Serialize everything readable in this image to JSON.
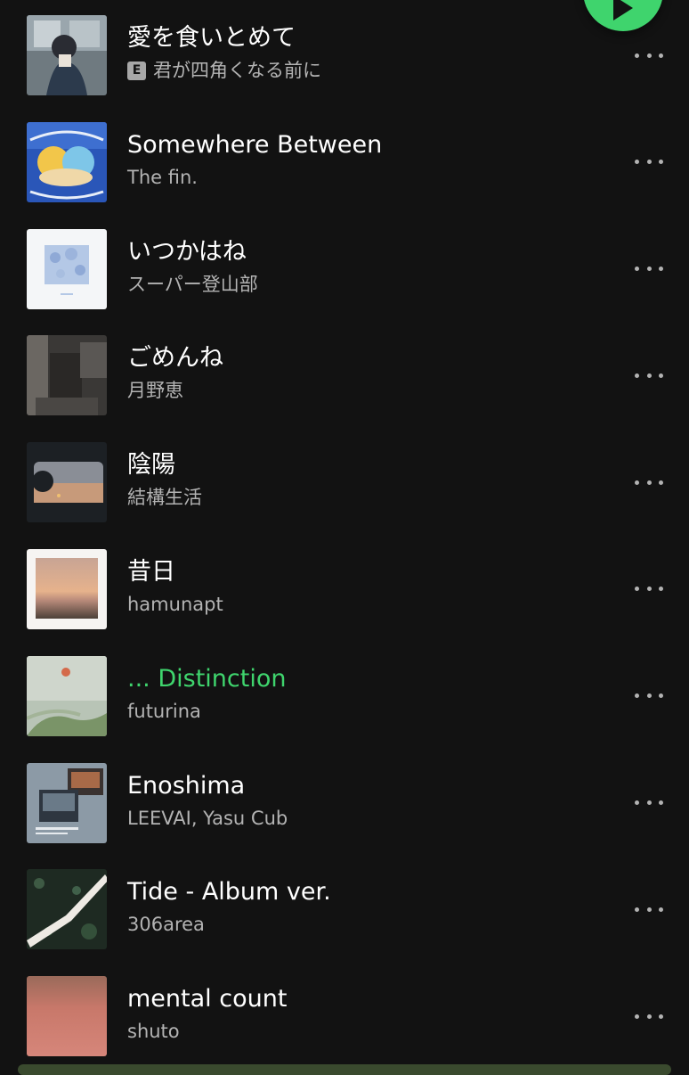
{
  "player": {
    "accent_color": "#3fd46d",
    "play_button_icon": "play-icon"
  },
  "tracks": [
    {
      "title": "愛を食いとめて",
      "artist": "君が四角くなる前に",
      "explicit": true,
      "explicit_label": "E",
      "active": false
    },
    {
      "title": "Somewhere Between",
      "artist": "The fin.",
      "explicit": false,
      "active": false
    },
    {
      "title": "いつかはね",
      "artist": "スーパー登山部",
      "explicit": false,
      "active": false
    },
    {
      "title": "ごめんね",
      "artist": "月野恵",
      "explicit": false,
      "active": false
    },
    {
      "title": "陰陽",
      "artist": "結構生活",
      "explicit": false,
      "active": false
    },
    {
      "title": "昔日",
      "artist": "hamunapt",
      "explicit": false,
      "active": false
    },
    {
      "title": "... Distinction",
      "artist": "futurina",
      "explicit": false,
      "active": true
    },
    {
      "title": "Enoshima",
      "artist": "LEEVAI, Yasu Cub",
      "explicit": false,
      "active": false
    },
    {
      "title": "Tide - Album ver.",
      "artist": "306area",
      "explicit": false,
      "active": false
    },
    {
      "title": "mental count",
      "artist": "shuto",
      "explicit": false,
      "active": false
    }
  ],
  "more_icon": "more-horizontal-icon"
}
